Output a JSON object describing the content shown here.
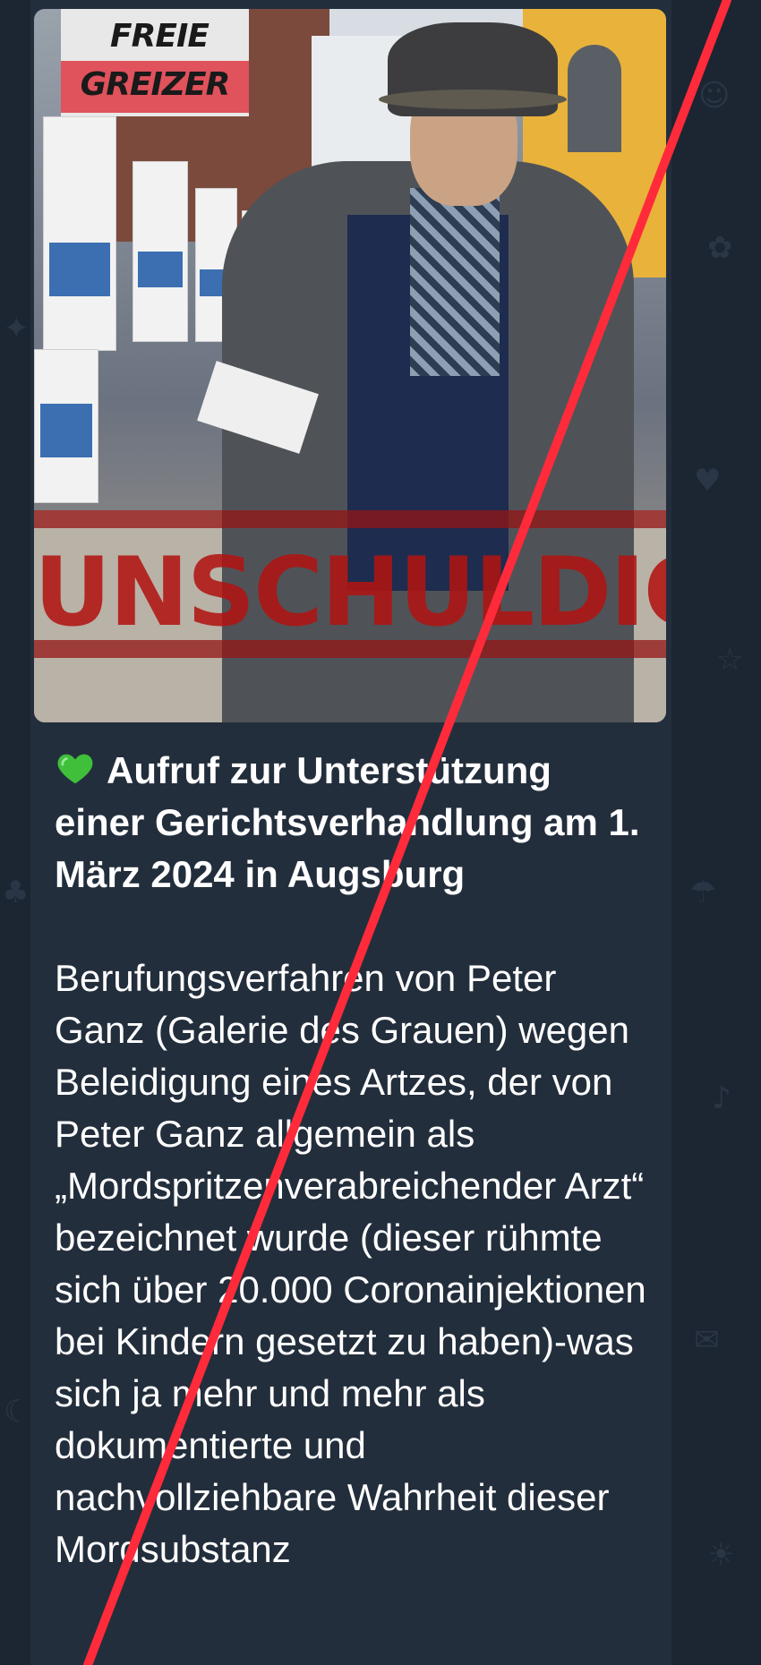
{
  "photo": {
    "logo_top": "FREIE",
    "logo_bottom": "GREIZER",
    "stamp_text": "UNSCHULDIG"
  },
  "message": {
    "headline": "Aufruf zur Unterstützung einer Gerichtsverhandlung am 1. März 2024 in Augsburg",
    "body": "Berufungsverfahren von Peter Ganz (Galerie des Grauen) wegen Beleidigung eines Artzes, der von Peter Ganz allgemein als „Mordspritzenverabreichender Arzt“ bezeichnet wurde (dieser rühmte sich über 20.000 Coronainjektionen bei Kindern gesetzt zu haben)-was sich ja mehr und mehr als dokumentierte und nachvollziehbare Wahrheit dieser Mordsubstanz"
  },
  "icons": {
    "heart": "green-heart-icon"
  },
  "colors": {
    "chat_background": "#1c2532",
    "bubble": "#232e3c",
    "text": "#ffffff",
    "heart": "#3fbf3a",
    "stamp": "#af1412",
    "slash": "#ff2b3a"
  }
}
